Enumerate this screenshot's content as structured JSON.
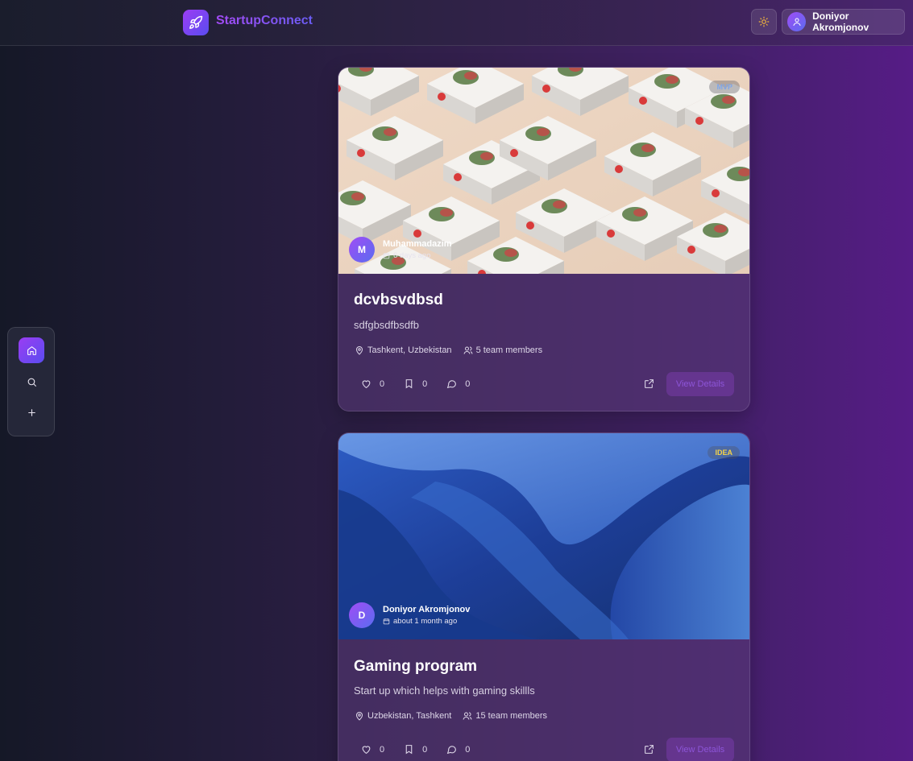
{
  "header": {
    "app_name": "StartupConnect",
    "user_name": "Doniyor Akromjonov"
  },
  "dock": {
    "items": [
      {
        "icon": "home-icon",
        "active": true
      },
      {
        "icon": "search-icon",
        "active": false
      },
      {
        "icon": "plus-icon",
        "active": false
      }
    ]
  },
  "cards": [
    {
      "badge": "MVP",
      "badge_color": "#7fa6e8",
      "author_initial": "M",
      "author_name": "Muhammadazim",
      "time": "6 days ago",
      "title": "dcvbsvdbsd",
      "description": "sdfgbsdfbsdfb",
      "location": "Tashkent, Uzbekistan",
      "team": "5 team members",
      "likes": "0",
      "saves": "0",
      "comments": "0",
      "button": "View Details"
    },
    {
      "badge": "IDEA",
      "badge_color": "#f2d24a",
      "author_initial": "D",
      "author_name": "Doniyor Akromjonov",
      "time": "about 1 month ago",
      "title": "Gaming program",
      "description": "Start up which helps with gaming skillls",
      "location": "Uzbekistan, Tashkent",
      "team": "15 team members",
      "likes": "0",
      "saves": "0",
      "comments": "0",
      "button": "View Details"
    }
  ],
  "colors": {
    "accent_start": "#9b3df3",
    "accent_end": "#5a4cf0"
  }
}
